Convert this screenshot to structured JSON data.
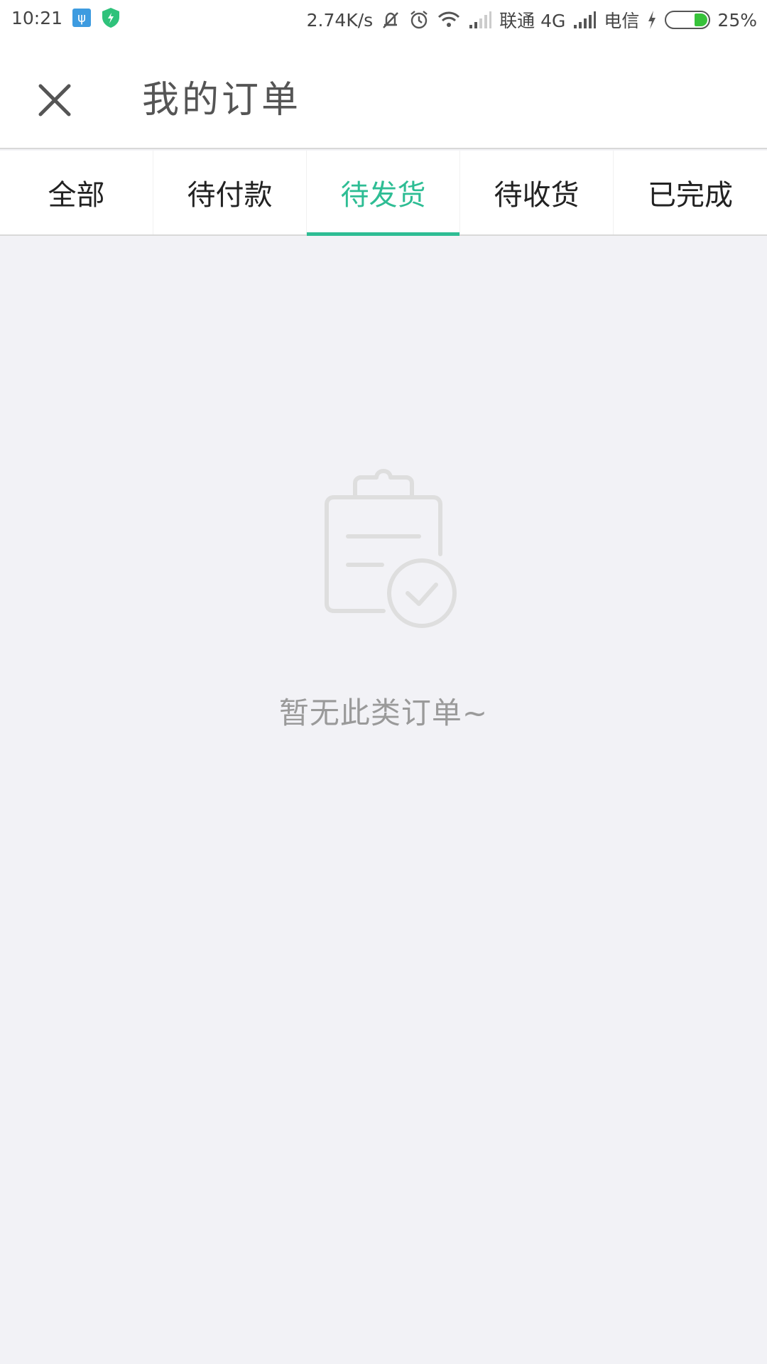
{
  "status_bar": {
    "time": "10:21",
    "speed": "2.74K/s",
    "carrier1": "联通 4G",
    "carrier2": "电信",
    "battery": "25%",
    "icons": [
      "usb-icon",
      "shield-icon",
      "mute-icon",
      "alarm-icon",
      "wifi-icon",
      "signal-icon",
      "charging-icon",
      "battery-icon"
    ]
  },
  "header": {
    "title": "我的订单",
    "close_icon": "close-icon"
  },
  "tabs": [
    {
      "label": "全部",
      "active": false
    },
    {
      "label": "待付款",
      "active": false
    },
    {
      "label": "待发货",
      "active": true
    },
    {
      "label": "待收货",
      "active": false
    },
    {
      "label": "已完成",
      "active": false
    }
  ],
  "empty_state": {
    "icon": "clipboard-check-icon",
    "message": "暂无此类订单~"
  },
  "colors": {
    "accent": "#2ebd94",
    "background": "#f2f2f6",
    "muted_text": "#9a9a9a"
  }
}
